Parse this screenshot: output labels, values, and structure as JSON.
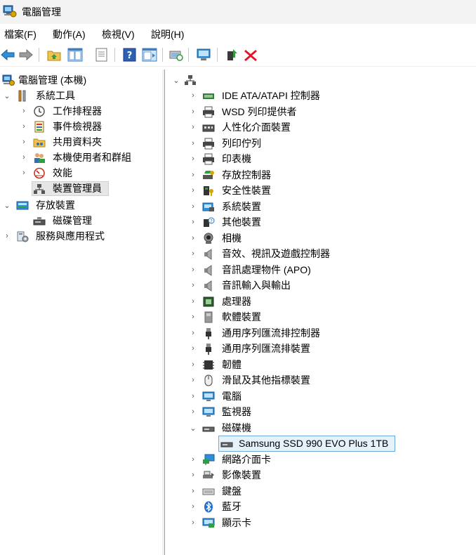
{
  "window": {
    "title": "電腦管理"
  },
  "menu": [
    "檔案(F)",
    "動作(A)",
    "檢視(V)",
    "說明(H)"
  ],
  "tree": {
    "root": "電腦管理 (本機)",
    "system_tools": "系統工具",
    "task_scheduler": "工作排程器",
    "event_viewer": "事件檢視器",
    "shared_folders": "共用資料夾",
    "local_users": "本機使用者和群組",
    "performance": "效能",
    "device_manager": "裝置管理員",
    "storage": "存放裝置",
    "disk_management": "磁碟管理",
    "services": "服務與應用程式"
  },
  "devices": [
    {
      "label": "IDE ATA/ATAPI 控制器",
      "icon": "ide-controller-icon"
    },
    {
      "label": "WSD 列印提供者",
      "icon": "printer-icon"
    },
    {
      "label": "人性化介面裝置",
      "icon": "hid-icon"
    },
    {
      "label": "列印佇列",
      "icon": "print-queue-icon"
    },
    {
      "label": "印表機",
      "icon": "printer-icon"
    },
    {
      "label": "存放控制器",
      "icon": "storage-controller-icon"
    },
    {
      "label": "安全性裝置",
      "icon": "security-device-icon"
    },
    {
      "label": "系統裝置",
      "icon": "system-device-icon"
    },
    {
      "label": "其他裝置",
      "icon": "other-device-icon"
    },
    {
      "label": "相機",
      "icon": "camera-icon"
    },
    {
      "label": "音效、視訊及遊戲控制器",
      "icon": "speaker-icon"
    },
    {
      "label": "音訊處理物件 (APO)",
      "icon": "speaker-icon"
    },
    {
      "label": "音訊輸入與輸出",
      "icon": "speaker-icon"
    },
    {
      "label": "處理器",
      "icon": "processor-icon"
    },
    {
      "label": "軟體裝置",
      "icon": "software-device-icon"
    },
    {
      "label": "通用序列匯流排控制器",
      "icon": "usb-icon"
    },
    {
      "label": "通用序列匯流排裝置",
      "icon": "usb-icon"
    },
    {
      "label": "韌體",
      "icon": "firmware-icon"
    },
    {
      "label": "滑鼠及其他指標裝置",
      "icon": "mouse-icon"
    },
    {
      "label": "電腦",
      "icon": "computer-icon"
    },
    {
      "label": "監視器",
      "icon": "monitor-icon"
    },
    {
      "label": "磁碟機",
      "icon": "disk-drive-icon",
      "expanded": true
    },
    {
      "label": "Samsung SSD 990 EVO Plus 1TB",
      "icon": "disk-drive-icon",
      "child": true,
      "selected": true
    },
    {
      "label": "網路介面卡",
      "icon": "network-adapter-icon"
    },
    {
      "label": "影像裝置",
      "icon": "imaging-device-icon"
    },
    {
      "label": "鍵盤",
      "icon": "keyboard-icon"
    },
    {
      "label": "藍牙",
      "icon": "bluetooth-icon"
    },
    {
      "label": "顯示卡",
      "icon": "display-adapter-icon"
    }
  ],
  "colors": {
    "selection": "#e5f1fb",
    "selection_border": "#6fa8dc",
    "delete_red": "#e81123"
  }
}
